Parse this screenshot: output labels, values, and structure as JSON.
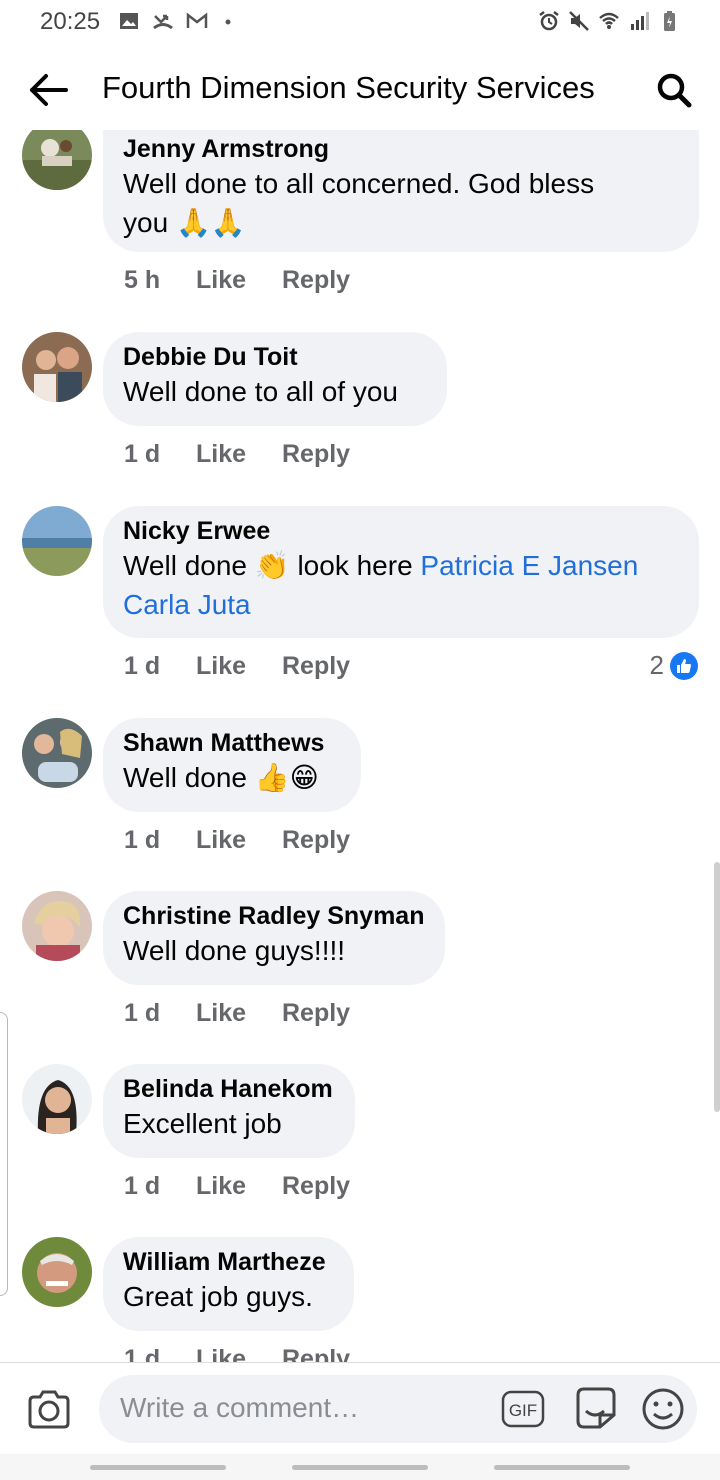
{
  "status_bar": {
    "time": "20:25"
  },
  "header": {
    "title": "Fourth Dimension Security Services"
  },
  "comments": [
    {
      "author": "Jenny Armstrong",
      "text": "Well done to all concerned. God bless",
      "text2": "you",
      "emoji": "🙏🙏",
      "time": "5 h",
      "like": "Like",
      "reply": "Reply"
    },
    {
      "author": "Debbie Du Toit",
      "text": "Well done to all of you",
      "time": "1 d",
      "like": "Like",
      "reply": "Reply"
    },
    {
      "author": "Nicky Erwee",
      "text_before": "Well done",
      "emoji": "👏",
      "text_after": "look here",
      "mention1": "Patricia E Jansen",
      "mention2": "Carla Juta",
      "time": "1 d",
      "like": "Like",
      "reply": "Reply",
      "reactions": "2"
    },
    {
      "author": "Shawn Matthews",
      "text": "Well done",
      "emoji": "👍😁",
      "time": "1 d",
      "like": "Like",
      "reply": "Reply"
    },
    {
      "author": "Christine Radley Snyman",
      "text": "Well done guys!!!!",
      "time": "1 d",
      "like": "Like",
      "reply": "Reply"
    },
    {
      "author": "Belinda Hanekom",
      "text": "Excellent job",
      "time": "1 d",
      "like": "Like",
      "reply": "Reply"
    },
    {
      "author": "William Martheze",
      "text": "Great job guys.",
      "time": "1 d",
      "like": "Like",
      "reply": "Reply"
    }
  ],
  "composer": {
    "placeholder": "Write a comment…",
    "gif_label": "GIF"
  },
  "colors": {
    "bubble": "#f0f2f5",
    "mention": "#216fdb",
    "meta": "#65676b",
    "like_blue": "#1877f2"
  }
}
